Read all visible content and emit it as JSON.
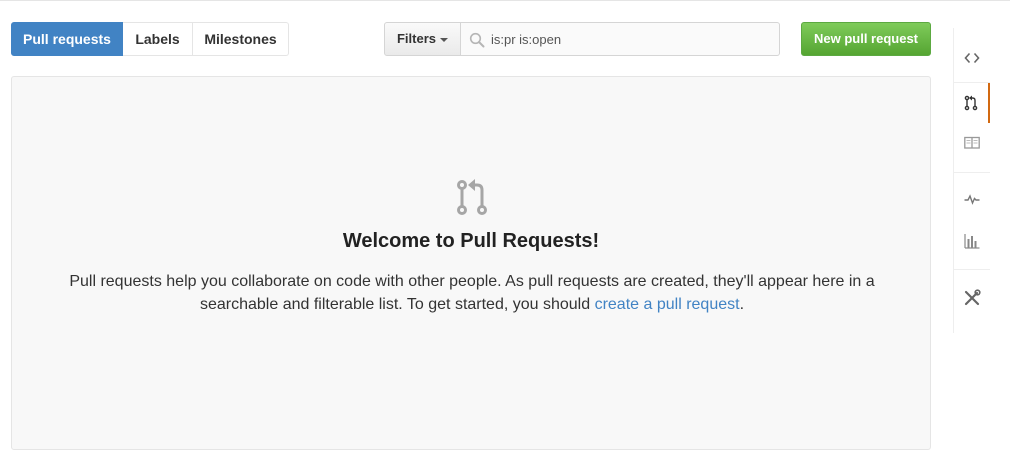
{
  "subnav": {
    "tabs": [
      {
        "label": "Pull requests",
        "selected": true
      },
      {
        "label": "Labels",
        "selected": false
      },
      {
        "label": "Milestones",
        "selected": false
      }
    ]
  },
  "filters": {
    "button_label": "Filters",
    "search_value": "is:pr is:open"
  },
  "new_pr_button": {
    "label": "New pull request"
  },
  "blankslate": {
    "icon": "git-pull-request-icon",
    "title": "Welcome to Pull Requests!",
    "text_before_link": "Pull requests help you collaborate on code with other people. As pull requests are created, they'll appear here in a searchable and filterable list. To get started, you should ",
    "link_text": "create a pull request",
    "text_after_link": "."
  },
  "repo_nav": {
    "items": [
      {
        "icon": "code-icon",
        "selected": false
      },
      {
        "icon": "git-pull-request-icon",
        "selected": true
      },
      {
        "icon": "book-icon",
        "selected": false
      },
      {
        "icon": "pulse-icon",
        "selected": false
      },
      {
        "icon": "graph-icon",
        "selected": false
      },
      {
        "icon": "tools-icon",
        "selected": false
      }
    ]
  },
  "colors": {
    "selected_tab": "#4183c4",
    "new_button": "#6cc644",
    "link": "#4183c4",
    "nav_selected_indicator": "#d26911"
  }
}
